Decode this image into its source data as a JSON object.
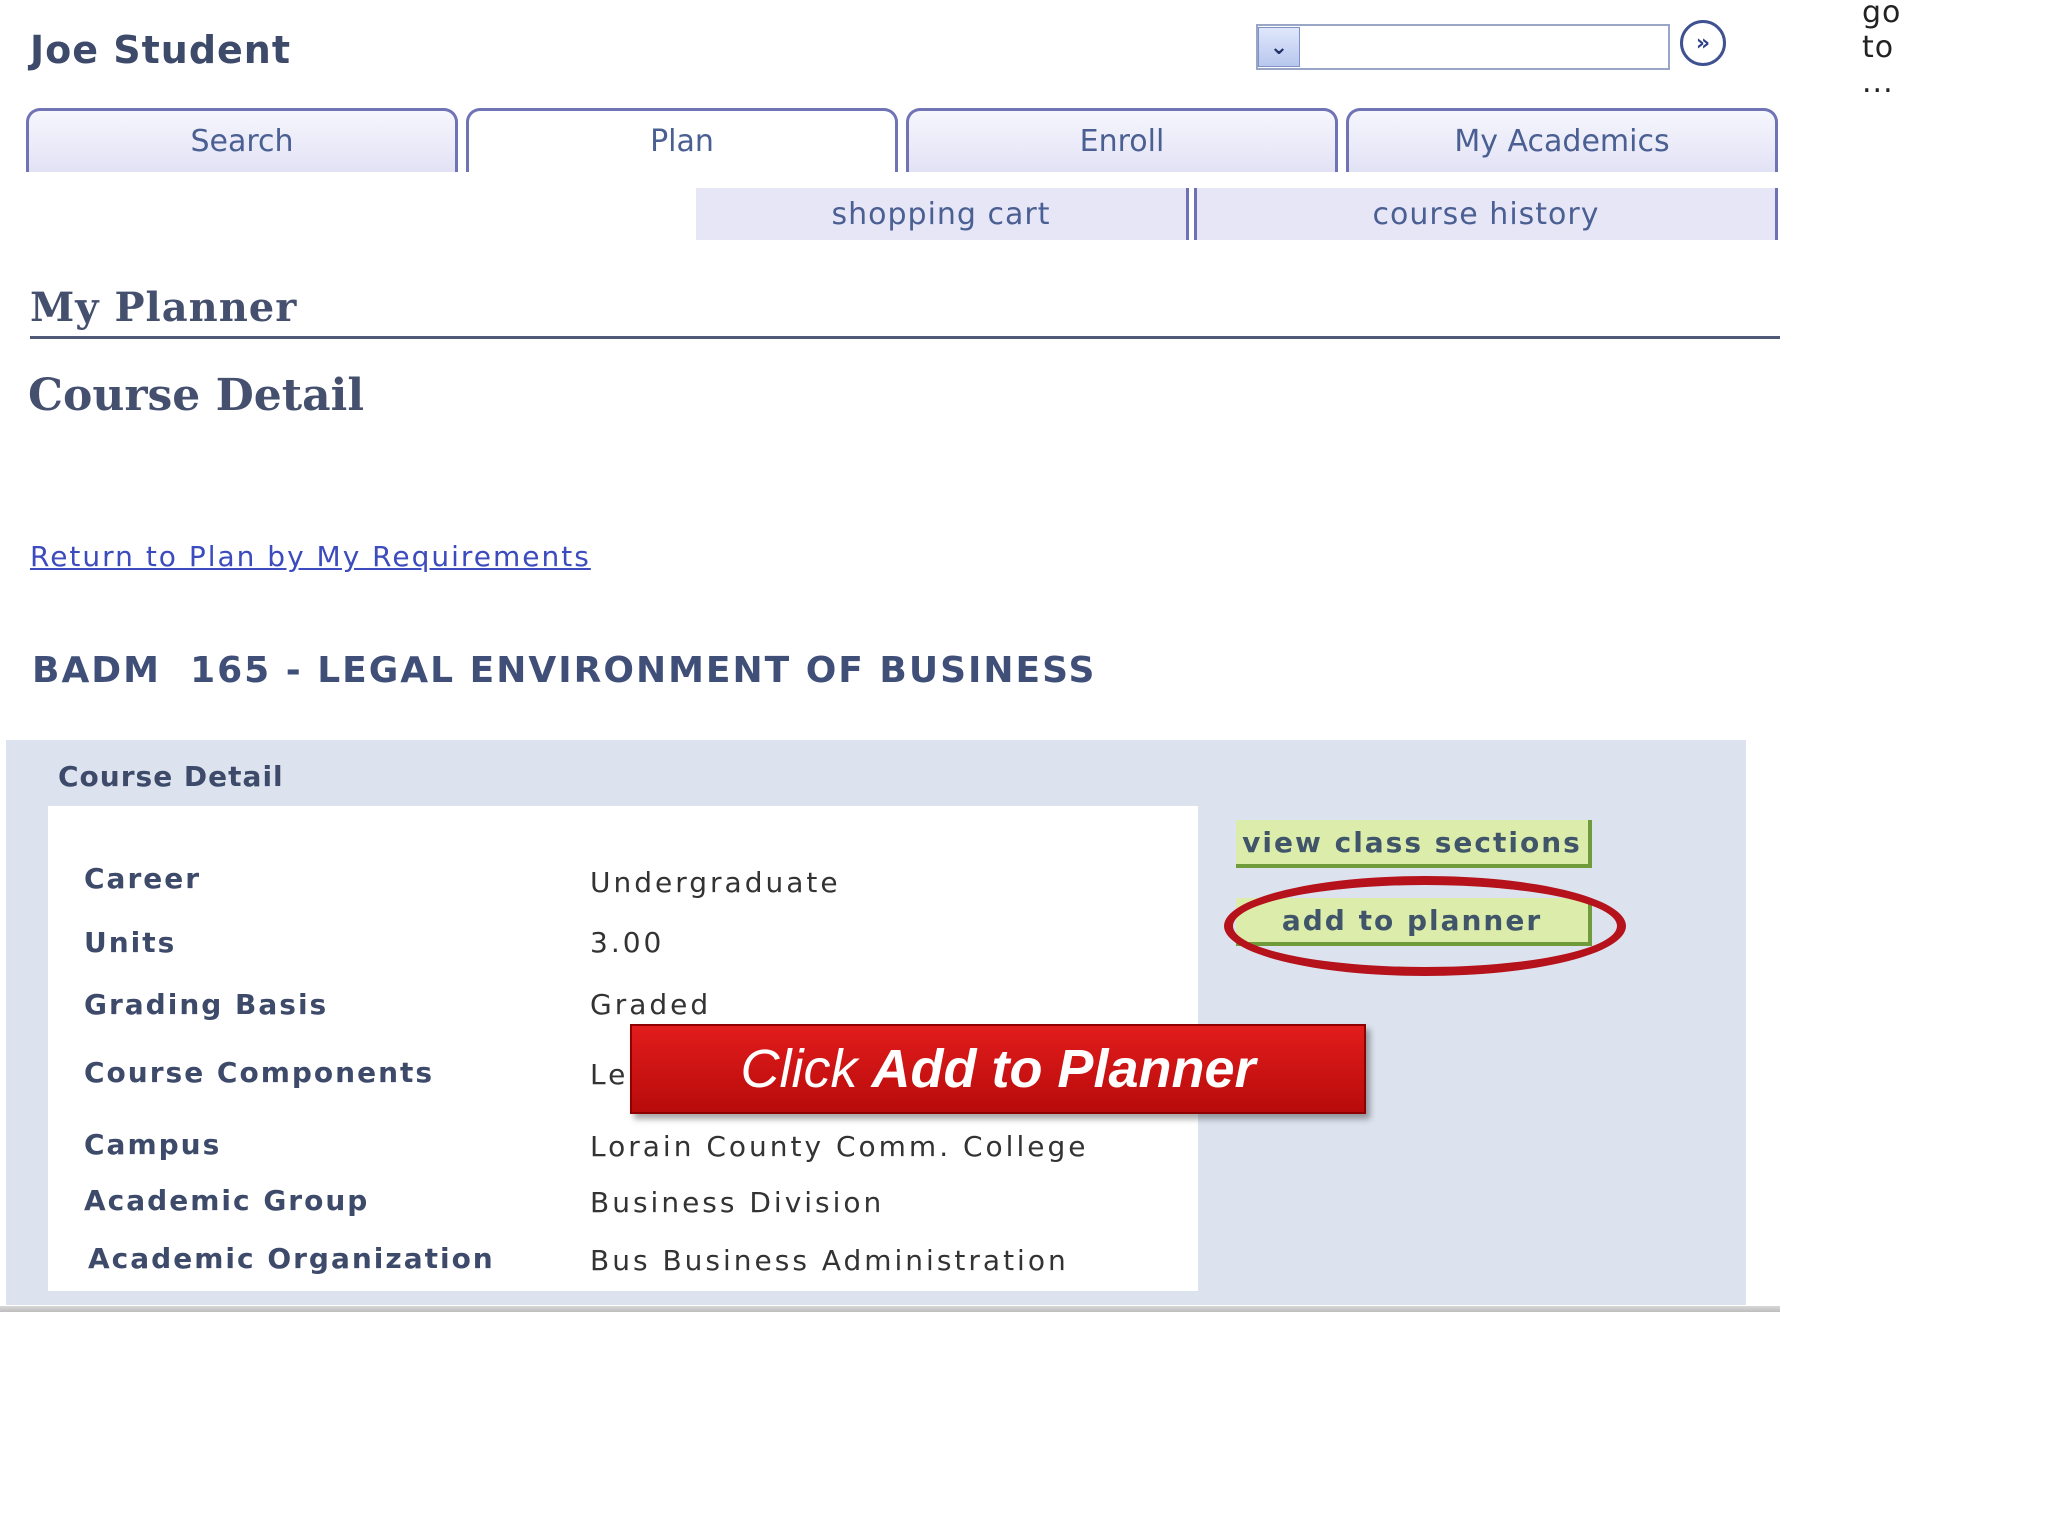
{
  "header": {
    "user_name": "Joe Student",
    "goto": {
      "value": "go to ..."
    },
    "go_icon": "double-chevron-right-icon"
  },
  "tabs": [
    {
      "label": "Search",
      "active": false
    },
    {
      "label": "Plan",
      "active": true
    },
    {
      "label": "Enroll",
      "active": false
    },
    {
      "label": "My Academics",
      "active": false
    }
  ],
  "subtabs": [
    {
      "label": "shopping cart"
    },
    {
      "label": "course history"
    }
  ],
  "page": {
    "section_title": "My Planner",
    "title": "Course Detail",
    "return_link": "Return to Plan by My Requirements",
    "course_heading": "BADM  165 - LEGAL ENVIRONMENT OF BUSINESS"
  },
  "panel": {
    "label": "Course Detail",
    "rows": [
      {
        "label": "Career",
        "value": "Undergraduate"
      },
      {
        "label": "Units",
        "value": "3.00"
      },
      {
        "label": "Grading Basis",
        "value": "Graded"
      },
      {
        "label": "Course Components",
        "value": "Le"
      },
      {
        "label": "Campus",
        "value": "Lorain County Comm. College"
      },
      {
        "label": "Academic Group",
        "value": "Business Division"
      },
      {
        "label": "Academic Organization",
        "value": "Bus Business Administration"
      }
    ],
    "buttons": {
      "view_class_sections": "view class sections",
      "add_to_planner": "add to planner"
    }
  },
  "callout": {
    "prefix": "Click",
    "emphasis": "Add to Planner"
  },
  "colors": {
    "tab_border": "#7073b4",
    "panel_bg": "#dde3ee",
    "button_bg": "#dcecab",
    "highlight": "#b5121b",
    "callout_bg": "#d01414"
  }
}
